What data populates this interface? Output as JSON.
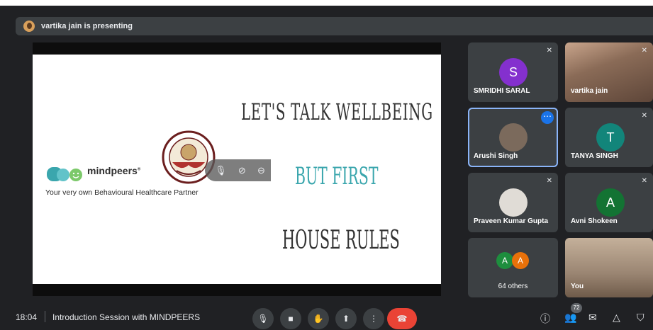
{
  "banner": {
    "text": "vartika jain is presenting"
  },
  "slide": {
    "brand_name": "mindpeers",
    "brand_mark": "®",
    "tagline": "Your very own Behavioural Healthcare Partner",
    "title1": "LET'S TALK WELLBEING",
    "title2": "BUT FIRST",
    "title3": "HOUSE RULES",
    "colors": {
      "accent_teal": "#3aa6ad"
    }
  },
  "participants": [
    {
      "name": "SMRIDHI SARAL",
      "initial": "S",
      "color": "#8430ce",
      "muted": true
    },
    {
      "name": "vartika jain",
      "photo": true,
      "muted": true
    },
    {
      "name": "Arushi Singh",
      "photo": true,
      "selected": true,
      "more_icon": "more-horiz-icon"
    },
    {
      "name": "TANYA SINGH",
      "initial": "T",
      "color": "#12857a",
      "muted": true
    },
    {
      "name": "Praveen Kumar Gupta",
      "photo": true,
      "muted": true
    },
    {
      "name": "Avni Shokeen",
      "initial": "A",
      "color": "#137333",
      "muted": true
    },
    {
      "name": "64 others",
      "initials": [
        "A",
        "A"
      ],
      "colors": [
        "#1e8e3e",
        "#e8710a"
      ]
    },
    {
      "name": "You",
      "photo": true
    }
  ],
  "bottom": {
    "time": "18:04",
    "meeting_title": "Introduction Session with MINDPEERS",
    "participant_count": "72",
    "colors": {
      "end_call": "#ea4335",
      "selected_outline": "#8ab4f8"
    }
  }
}
